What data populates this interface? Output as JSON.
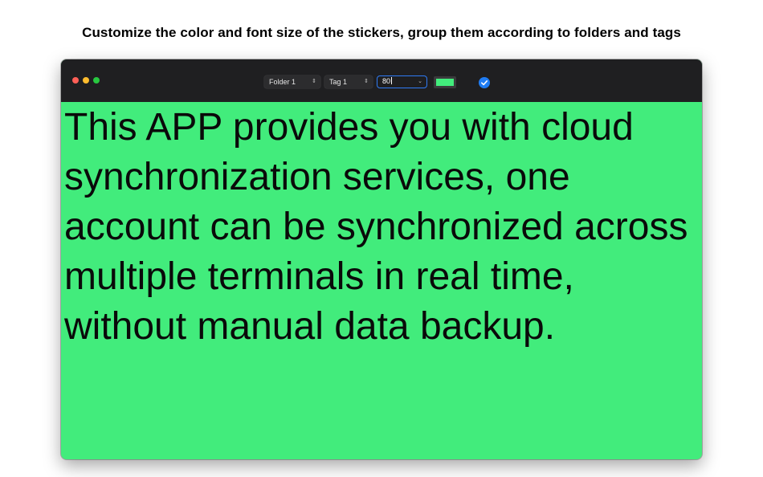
{
  "headline": "Customize the color and font size of the stickers, group them according to folders and tags",
  "window": {
    "toolbar": {
      "folder": {
        "value": "Folder 1",
        "icon": "up-down-chevron-icon"
      },
      "tag": {
        "value": "Tag 1",
        "icon": "up-down-chevron-icon"
      },
      "font_size": {
        "value": "80",
        "icon": "chevron-down-icon"
      },
      "color": {
        "value": "#42ec7c"
      },
      "confirm": {
        "icon": "checkmark-circle-icon",
        "color": "#1f7cf3"
      }
    },
    "traffic_lights": [
      "#fe5f57",
      "#febc2e",
      "#28c840"
    ],
    "sticker": {
      "background": "#42ec7c",
      "text": "This APP provides you with cloud synchronization services, one account can be synchronized across multiple terminals in real time, without manual data backup."
    }
  }
}
